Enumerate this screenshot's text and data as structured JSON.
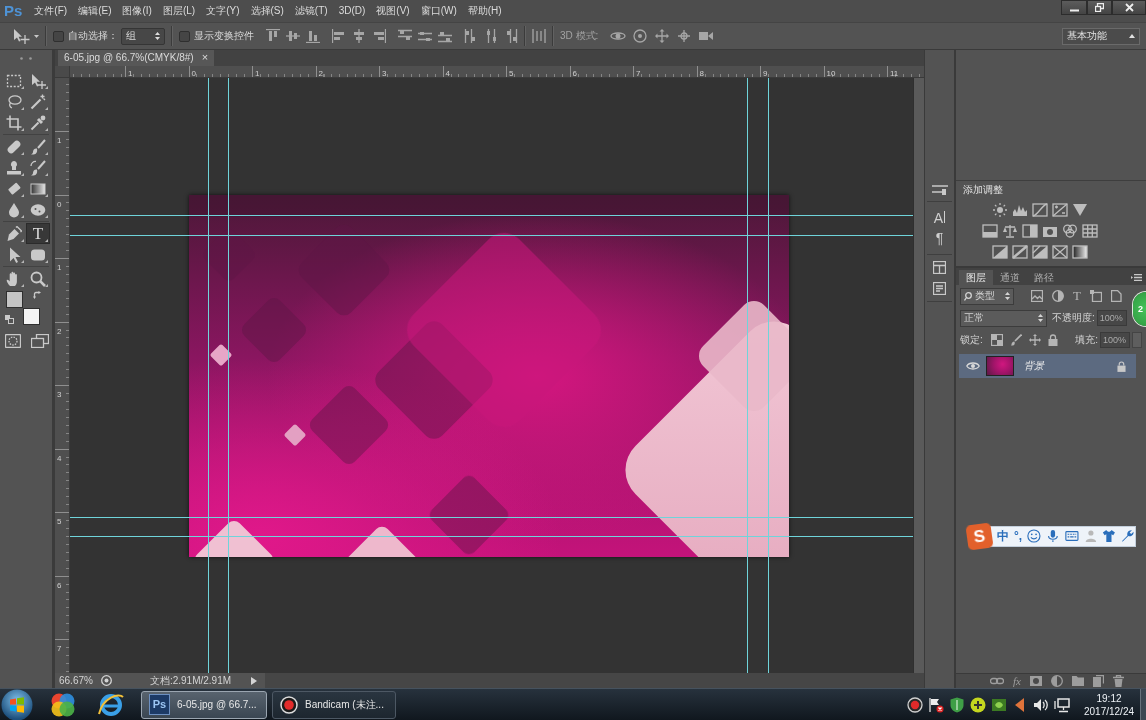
{
  "app": {
    "logo": "Ps"
  },
  "menu": [
    "文件(F)",
    "编辑(E)",
    "图像(I)",
    "图层(L)",
    "文字(Y)",
    "选择(S)",
    "滤镜(T)",
    "3D(D)",
    "视图(V)",
    "窗口(W)",
    "帮助(H)"
  ],
  "options_bar": {
    "auto_select": {
      "label": "自动选择：",
      "checked": false
    },
    "auto_select_target": "组",
    "show_transform_controls": {
      "label": "显示变换控件",
      "checked": false
    },
    "mode_3d_label": "3D 模式:",
    "workspace": "基本功能"
  },
  "toolbar": {
    "tools": [
      {
        "kind": "marquee",
        "selected": false
      },
      {
        "kind": "move",
        "selected": false
      },
      {
        "kind": "lasso",
        "selected": false
      },
      {
        "kind": "wand",
        "selected": false
      },
      {
        "kind": "crop",
        "selected": false
      },
      {
        "kind": "eyedropper",
        "selected": false
      },
      {
        "kind": "healing",
        "selected": false
      },
      {
        "kind": "brush",
        "selected": false
      },
      {
        "kind": "stamp",
        "selected": false
      },
      {
        "kind": "historybrush",
        "selected": false
      },
      {
        "kind": "eraser",
        "selected": false
      },
      {
        "kind": "gradient",
        "selected": false
      },
      {
        "kind": "blur",
        "selected": false
      },
      {
        "kind": "sponge",
        "selected": false
      },
      {
        "kind": "pen",
        "selected": false
      },
      {
        "kind": "type",
        "selected": true,
        "glyph": "T"
      },
      {
        "kind": "pathselect",
        "selected": false
      },
      {
        "kind": "shape",
        "selected": false
      },
      {
        "kind": "hand",
        "selected": false
      },
      {
        "kind": "zoom",
        "selected": false
      }
    ],
    "swatches": [
      {
        "kind": "foreground",
        "color": "#c4c4c4"
      },
      {
        "kind": "background",
        "color": "#f4f4f4"
      }
    ]
  },
  "document": {
    "tab": {
      "title": "6-05.jpg @ 66.7%(CMYK/8#)",
      "close": "×"
    },
    "ruler_horizontal": [
      "1",
      "0",
      "1",
      "2",
      "3",
      "4",
      "5",
      "6",
      "7",
      "8",
      "9",
      "10",
      "11"
    ],
    "ruler_vertical": [
      "1",
      "0",
      "1",
      "2",
      "3",
      "4",
      "5",
      "6",
      "7"
    ]
  },
  "status_bar": {
    "zoom": "66.67%",
    "document_size": "文档:2.91M/2.91M"
  },
  "dock": {
    "character_glyph": "A",
    "paragraph_glyph": "¶"
  },
  "adjustments": {
    "title": "添加调整"
  },
  "layers_panel": {
    "tabs": [
      {
        "label": "图层",
        "selected": true
      },
      {
        "label": "通道",
        "selected": false
      },
      {
        "label": "路径",
        "selected": false
      }
    ],
    "filter": {
      "value": "类型",
      "type_glyph": "T"
    },
    "blend_mode": "正常",
    "opacity": {
      "label": "不透明度:",
      "value": "100%",
      "disabled": true
    },
    "lock_label": "锁定:",
    "fill": {
      "label": "填充:",
      "value": "100%",
      "disabled": true
    },
    "layers": [
      {
        "name": "背景",
        "visible": true,
        "selected": true,
        "locked": true
      }
    ],
    "style_button": "fx"
  },
  "floating_counter": {
    "text": "2"
  },
  "ime_toolbar": {
    "logo": "S",
    "mode": "中",
    "punctuation": "°,"
  },
  "taskbar": {
    "tasks": [
      {
        "icon_text": "Ps",
        "label": "6-05.jpg @ 66.7...",
        "selected": true
      },
      {
        "label": "Bandicam (未注...",
        "selected": false
      }
    ],
    "clock": {
      "time": "19:12",
      "date": "2017/12/24"
    }
  }
}
